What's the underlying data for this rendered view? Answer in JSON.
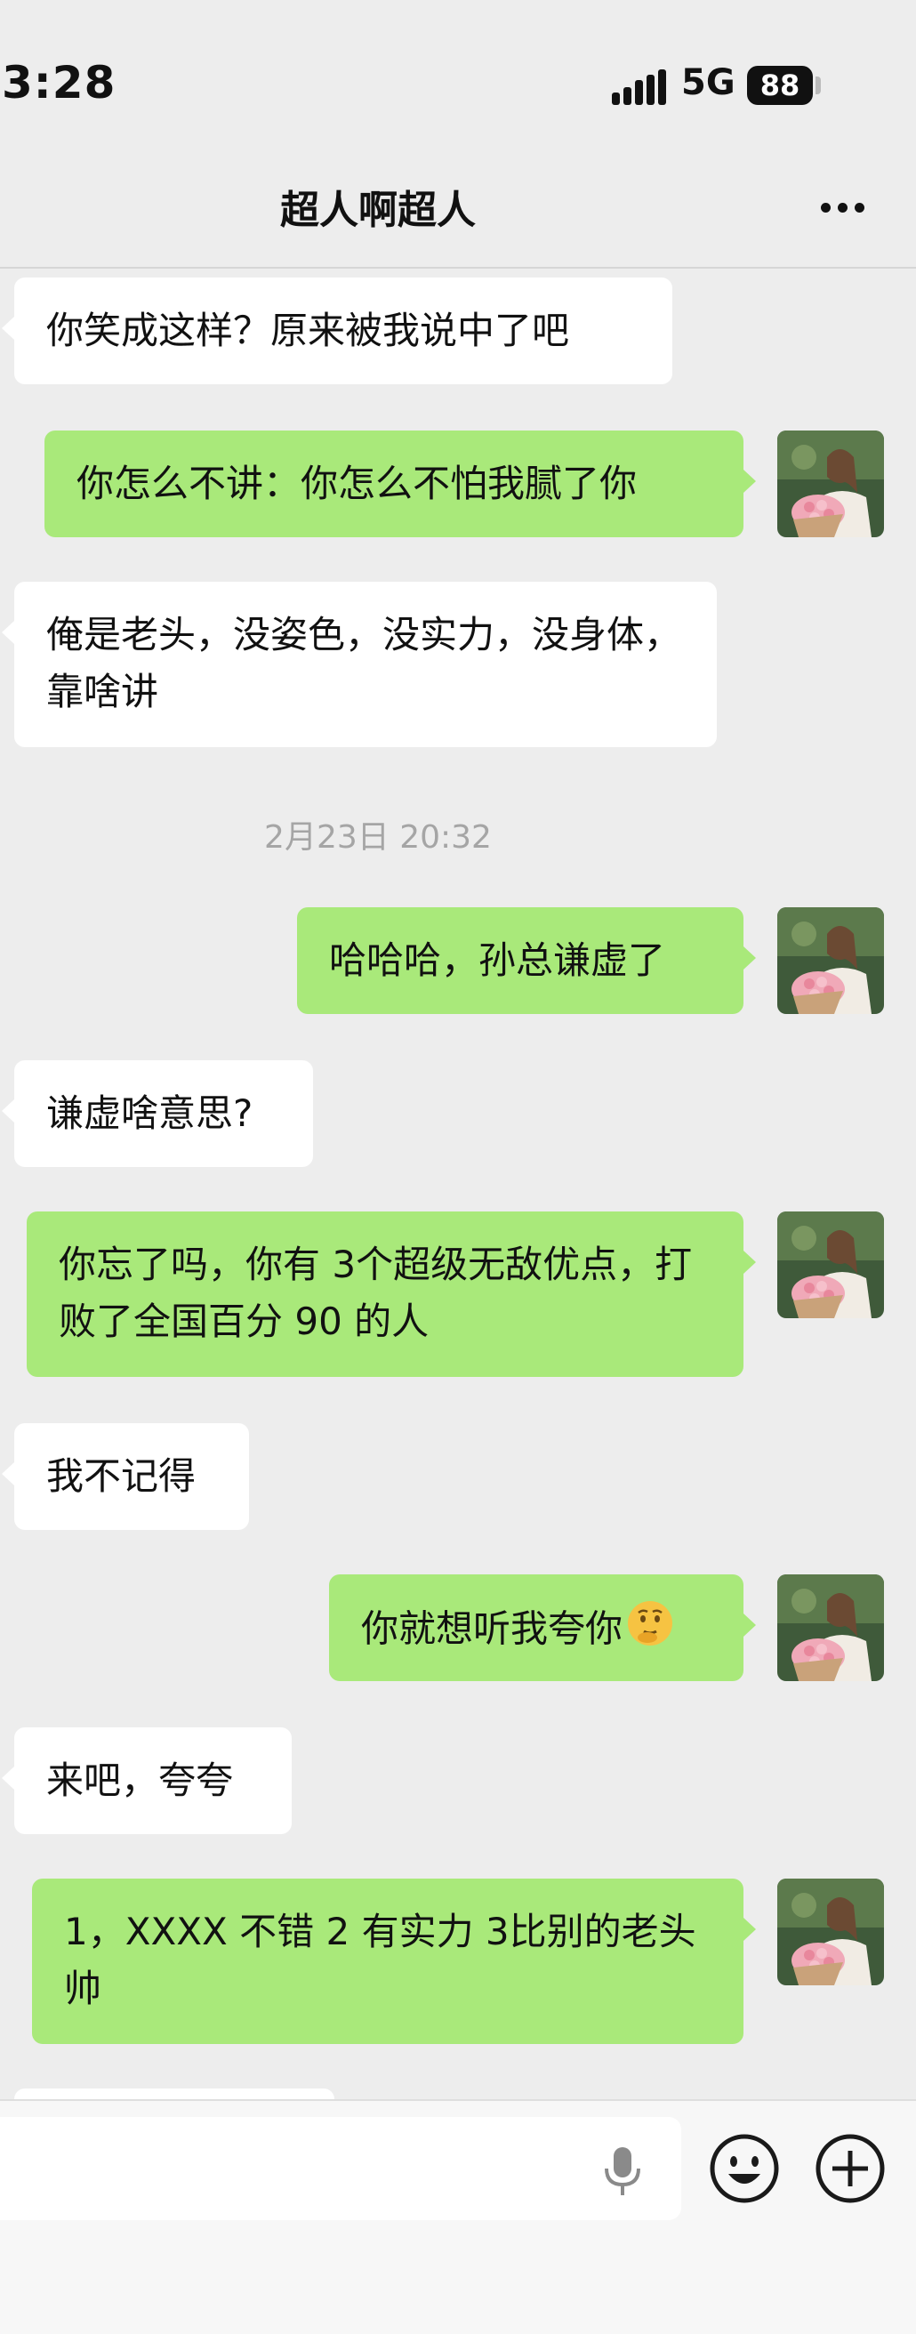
{
  "status_bar": {
    "time": "3:28",
    "network": "5G",
    "battery": "88"
  },
  "header": {
    "title": "超人啊超人"
  },
  "messages": [
    {
      "side": "left",
      "text": "你笑成这样？原来被我说中了吧"
    },
    {
      "side": "right",
      "text": "你怎么不讲：你怎么不怕我腻了你"
    },
    {
      "side": "left",
      "text": "俺是老头，没姿色，没实力，没身体，靠啥讲"
    },
    {
      "side": "right",
      "text": "哈哈哈，孙总谦虚了"
    },
    {
      "side": "left",
      "text": "谦虚啥意思?"
    },
    {
      "side": "right",
      "text": "你忘了吗，你有 3个超级无敌优点，打败了全国百分 90 的人"
    },
    {
      "side": "left",
      "text": "我不记得"
    },
    {
      "side": "right",
      "text": "你就想听我夸你",
      "emoji": "thinking-face-emoji"
    },
    {
      "side": "left",
      "text": "来吧，夸夸"
    },
    {
      "side": "right",
      "text": "1，XXXX 不错 2 有实力 3比别的老头帅"
    }
  ],
  "timestamp": "2月23日 20:32",
  "input_bar": {
    "icons": [
      "microphone-icon",
      "emoji-icon",
      "plus-icon"
    ]
  },
  "colors": {
    "background": "#ededed",
    "outgoing_bubble": "#a9e97a",
    "incoming_bubble": "#ffffff",
    "timestamp": "#a5a5a5"
  }
}
